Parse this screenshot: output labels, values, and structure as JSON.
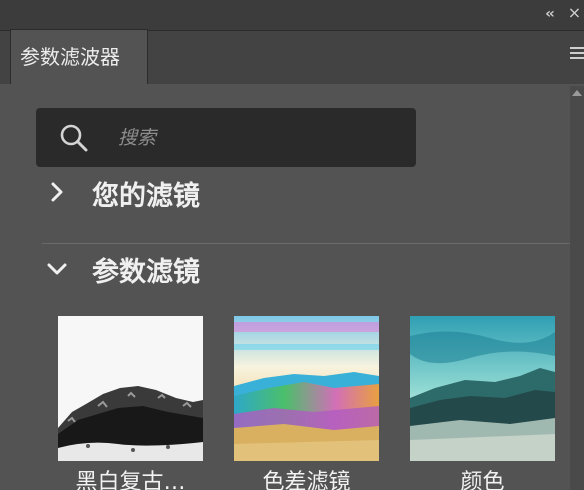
{
  "window": {
    "collapse_icon": "double-chevron-left-icon",
    "close_icon": "close-icon"
  },
  "panel": {
    "tab_label": "参数滤波器",
    "menu_icon": "hamburger-menu-icon"
  },
  "search": {
    "placeholder": "搜索",
    "value": ""
  },
  "sections": [
    {
      "label": "您的滤镜",
      "state": "collapsed",
      "icon": "chevron-right-icon"
    },
    {
      "label": "参数滤镜",
      "state": "expanded",
      "icon": "chevron-down-icon"
    }
  ],
  "filters": [
    {
      "label": "黑白复古…"
    },
    {
      "label": "色差滤镜"
    },
    {
      "label": "颜色"
    }
  ],
  "colors": {
    "panel_bg": "#535353",
    "topbar_bg": "#3c3c3c",
    "tabstrip_bg": "#434343",
    "search_bg": "#2a2a2a",
    "text": "#f0f0f0"
  }
}
